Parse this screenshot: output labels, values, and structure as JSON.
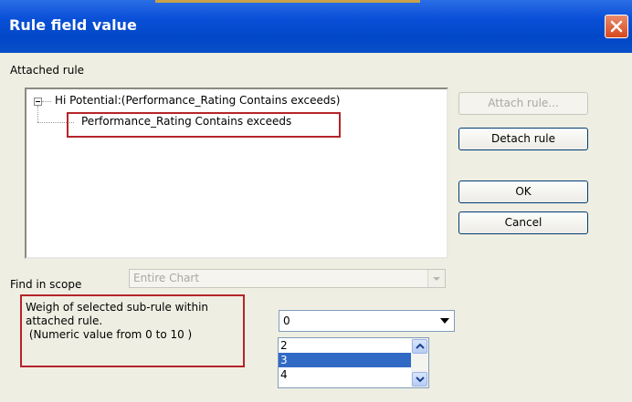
{
  "window": {
    "title": "Rule field value"
  },
  "attached_rule": {
    "label": "Attached rule",
    "tree": {
      "root": "Hi Potential:(Performance_Rating Contains exceeds)",
      "child": "Performance_Rating Contains exceeds"
    }
  },
  "buttons": {
    "attach": "Attach rule...",
    "detach": "Detach rule",
    "ok": "OK",
    "cancel": "Cancel"
  },
  "scope": {
    "label": "Find in scope",
    "value": "Entire Chart"
  },
  "weight": {
    "line1": "Weigh of selected sub-rule within",
    "line2": "attached rule.",
    "line3": " (Numeric value from 0 to 10 )",
    "selected": "0",
    "options": [
      "2",
      "3",
      "4"
    ],
    "highlighted_option": "3"
  },
  "colors": {
    "title_bar": "#0047c8",
    "highlight": "#316ac5",
    "annotation_box": "#b5242a",
    "dialog_face": "#efeee2"
  }
}
